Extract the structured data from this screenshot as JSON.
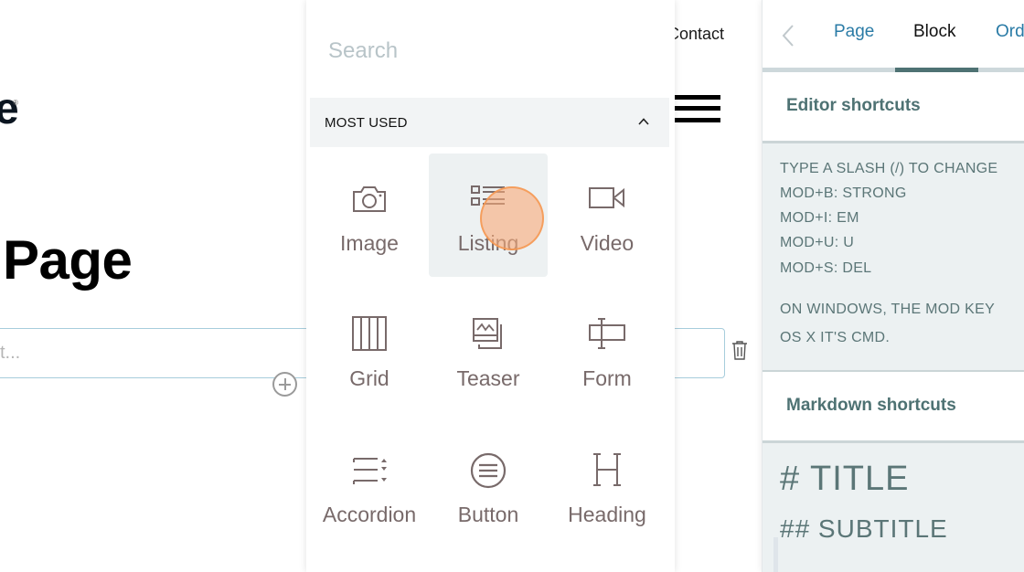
{
  "page": {
    "logo_fragment": "e",
    "logo_registered": "®",
    "title_fragment": "Page",
    "text_placeholder_fragment": "t...",
    "nav_link_fragment": "Contact",
    "icons": {
      "add_block": "plus-circle-icon",
      "delete_block": "trash-icon",
      "menu": "hamburger-icon"
    }
  },
  "chooser": {
    "search_placeholder": "Search",
    "group": {
      "title": "MOST USED",
      "expanded": true,
      "chevron": "chevron-up-icon"
    },
    "blocks": [
      {
        "label": "Image",
        "icon": "camera-icon",
        "active": false
      },
      {
        "label": "Listing",
        "icon": "listing-icon",
        "active": true
      },
      {
        "label": "Video",
        "icon": "video-camera-icon",
        "active": false
      },
      {
        "label": "Grid",
        "icon": "grid-columns-icon",
        "active": false
      },
      {
        "label": "Teaser",
        "icon": "teaser-image-icon",
        "active": false
      },
      {
        "label": "Form",
        "icon": "form-field-icon",
        "active": false
      },
      {
        "label": "Accordion",
        "icon": "accordion-icon",
        "active": false
      },
      {
        "label": "Button",
        "icon": "button-circle-icon",
        "active": false
      },
      {
        "label": "Heading",
        "icon": "heading-h-icon",
        "active": false
      }
    ]
  },
  "sidebar": {
    "tabs": [
      {
        "label": "Page",
        "active": false
      },
      {
        "label": "Block",
        "active": true
      },
      {
        "label": "Order",
        "active": false
      }
    ],
    "editor_shortcuts": {
      "title": "Editor shortcuts",
      "lines": [
        "TYPE A SLASH (/) TO CHANGE",
        "MOD+B: STRONG",
        "MOD+I: EM",
        "MOD+U: U",
        "MOD+S: DEL"
      ],
      "note_lines": [
        "ON WINDOWS, THE MOD KEY",
        "OS X IT'S CMD."
      ]
    },
    "markdown_shortcuts": {
      "title": "Markdown shortcuts",
      "title_example": "# TITLE",
      "subtitle_example": "## SUBTITLE"
    }
  },
  "colors": {
    "accent_link": "#2a7ba6",
    "sidebar_heading": "#4e7273",
    "sidebar_text": "#5b7677",
    "panel_bg": "#ecf1f2",
    "block_icon": "#786a6a",
    "click_marker": "#f8aa78"
  }
}
